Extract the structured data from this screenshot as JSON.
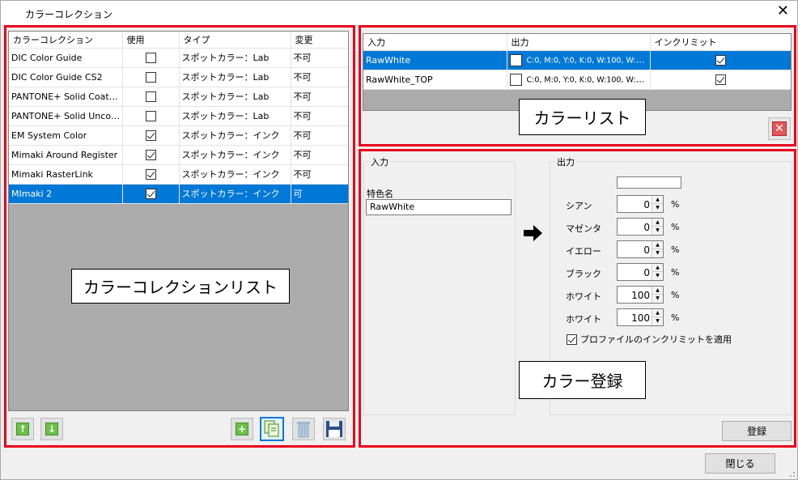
{
  "window": {
    "title": "カラーコレクション",
    "close_glyph": "✕"
  },
  "collections": {
    "headers": [
      "カラーコレクション",
      "使用",
      "タイプ",
      "変更"
    ],
    "rows": [
      {
        "name": "DIC Color Guide",
        "use": false,
        "type": "スポットカラー：Lab",
        "change": "不可"
      },
      {
        "name": "DIC Color Guide CS2",
        "use": false,
        "type": "スポットカラー：Lab",
        "change": "不可"
      },
      {
        "name": "PANTONE+ Solid Coate...",
        "use": false,
        "type": "スポットカラー：Lab",
        "change": "不可"
      },
      {
        "name": "PANTONE+ Solid Uncoa...",
        "use": false,
        "type": "スポットカラー：Lab",
        "change": "不可"
      },
      {
        "name": "EM System Color",
        "use": true,
        "type": "スポットカラー：インク",
        "change": "不可"
      },
      {
        "name": "Mimaki Around Register",
        "use": true,
        "type": "スポットカラー：インク",
        "change": "不可"
      },
      {
        "name": "Mimaki RasterLink",
        "use": true,
        "type": "スポットカラー：インク",
        "change": "不可"
      },
      {
        "name": "MImaki 2",
        "use": true,
        "type": "スポットカラー：インク",
        "change": "可",
        "selected": true
      }
    ],
    "label": "カラーコレクションリスト"
  },
  "colorlist": {
    "headers": [
      "入力",
      "出力",
      "インクリミット"
    ],
    "rows": [
      {
        "input": "RawWhite",
        "output": "C:0, M:0, Y:0, K:0, W:100, W:100",
        "ink_limit": true,
        "selected": true
      },
      {
        "input": "RawWhite_TOP",
        "output": "C:0, M:0, Y:0, K:0, W:100, W:100",
        "ink_limit": true
      }
    ],
    "label": "カラーリスト"
  },
  "register": {
    "input_group": "入力",
    "spot_name_label": "特色名",
    "spot_name_value": "RawWhite",
    "output_group": "出力",
    "channels": [
      {
        "label": "シアン",
        "value": "0"
      },
      {
        "label": "マゼンタ",
        "value": "0"
      },
      {
        "label": "イエロー",
        "value": "0"
      },
      {
        "label": "ブラック",
        "value": "0"
      },
      {
        "label": "ホワイト",
        "value": "100"
      },
      {
        "label": "ホワイト",
        "value": "100"
      }
    ],
    "percent": "%",
    "apply_ink_limit_label": "プロファイルのインクリミットを適用",
    "apply_ink_limit": true,
    "register_button": "登録",
    "label": "カラー登録"
  },
  "footer": {
    "close_button": "閉じる"
  },
  "colors": {
    "selection": "#0078d7",
    "highlight_border": "#e8001c"
  }
}
